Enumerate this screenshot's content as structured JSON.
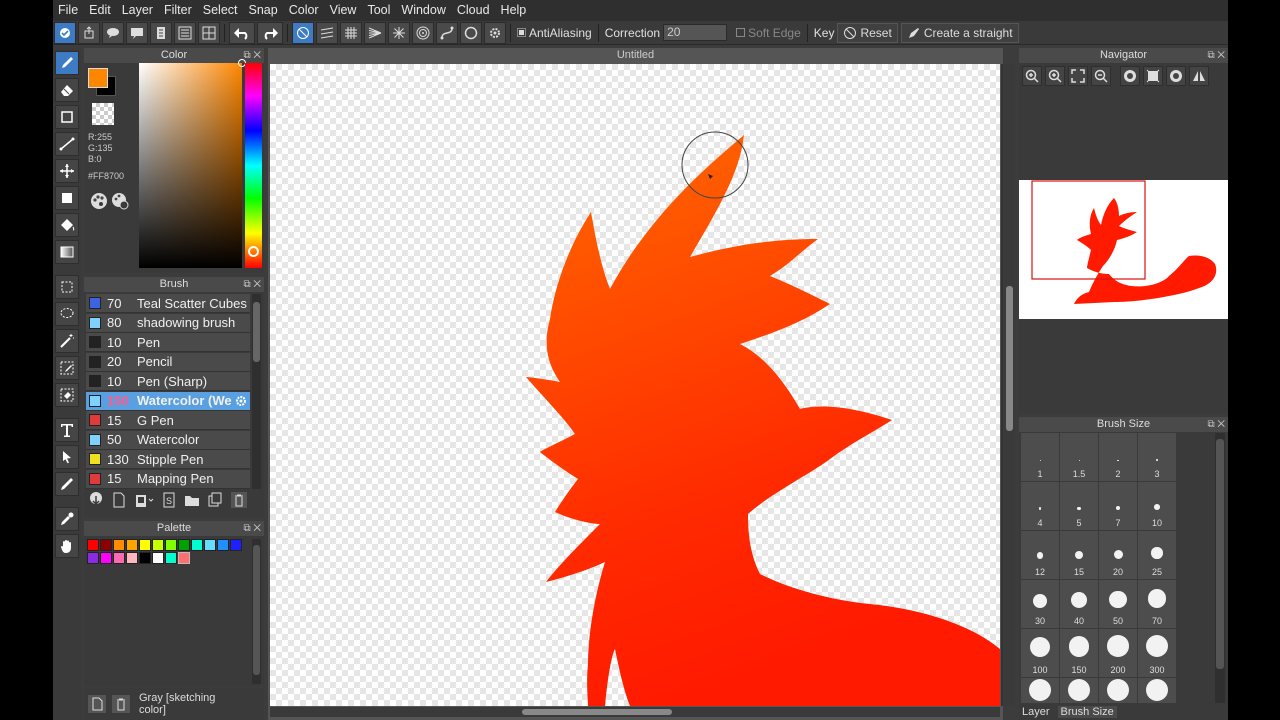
{
  "menu": [
    "File",
    "Edit",
    "Layer",
    "Filter",
    "Select",
    "Snap",
    "Color",
    "View",
    "Tool",
    "Window",
    "Cloud",
    "Help"
  ],
  "toolbar": {
    "antialiasing_label": "AntiAliasing",
    "correction_label": "Correction",
    "correction_value": "20",
    "soft_edge_label": "Soft Edge",
    "key_label": "Key",
    "reset_label": "Reset",
    "straight_label": "Create a straight"
  },
  "color_panel": {
    "title": "Color",
    "r": "R:255",
    "g": "G:135",
    "b": "B:0",
    "hex": "#FF8700",
    "fg_color": "#ff8700",
    "bg_color": "#000000"
  },
  "brush_panel": {
    "title": "Brush",
    "items": [
      {
        "size": "70",
        "name": "Teal Scatter Cubes",
        "color": "#3d63e0"
      },
      {
        "size": "80",
        "name": "shadowing brush",
        "color": "#7fd2ff"
      },
      {
        "size": "10",
        "name": "Pen",
        "color": "#222222"
      },
      {
        "size": "20",
        "name": "Pencil",
        "color": "#222222"
      },
      {
        "size": "10",
        "name": "Pen (Sharp)",
        "color": "#222222"
      },
      {
        "size": "150",
        "name": "Watercolor (We",
        "color": "#7fd2ff"
      },
      {
        "size": "15",
        "name": "G Pen",
        "color": "#e03a3a"
      },
      {
        "size": "50",
        "name": "Watercolor",
        "color": "#7fd2ff"
      },
      {
        "size": "130",
        "name": "Stipple Pen",
        "color": "#f0e020"
      },
      {
        "size": "15",
        "name": "Mapping Pen",
        "color": "#e03a3a"
      }
    ]
  },
  "palette_panel": {
    "title": "Palette",
    "colors": [
      "#ff0000",
      "#8b0000",
      "#ff8c00",
      "#ffa500",
      "#ffff00",
      "#c8ff00",
      "#7fff00",
      "#00a000",
      "#00ffd0",
      "#66ddff",
      "#1e90ff",
      "#2020ff",
      "#8a2be2",
      "#ff00ff",
      "#ff69b4",
      "#ffb6c1",
      "#000000",
      "#ffffff",
      "#00ffcc",
      "#ff6f6f"
    ],
    "footer_label": "Gray [sketching color]"
  },
  "canvas": {
    "title": "Untitled",
    "fill_color": "#ff1a00"
  },
  "navigator": {
    "title": "Navigator"
  },
  "brush_size_panel": {
    "title": "Brush Size",
    "sizes": [
      "1",
      "1.5",
      "2",
      "3",
      "4",
      "5",
      "7",
      "10",
      "12",
      "15",
      "20",
      "25",
      "30",
      "40",
      "50",
      "70",
      "100",
      "150",
      "200",
      "300"
    ],
    "dots": [
      0.02,
      0.025,
      0.035,
      0.05,
      0.07,
      0.09,
      0.12,
      0.16,
      0.19,
      0.22,
      0.25,
      0.32,
      0.38,
      0.44,
      0.48,
      0.52,
      0.56,
      0.58,
      0.6,
      0.62
    ]
  },
  "bottom_tabs": [
    "Layer",
    "Brush Size"
  ]
}
